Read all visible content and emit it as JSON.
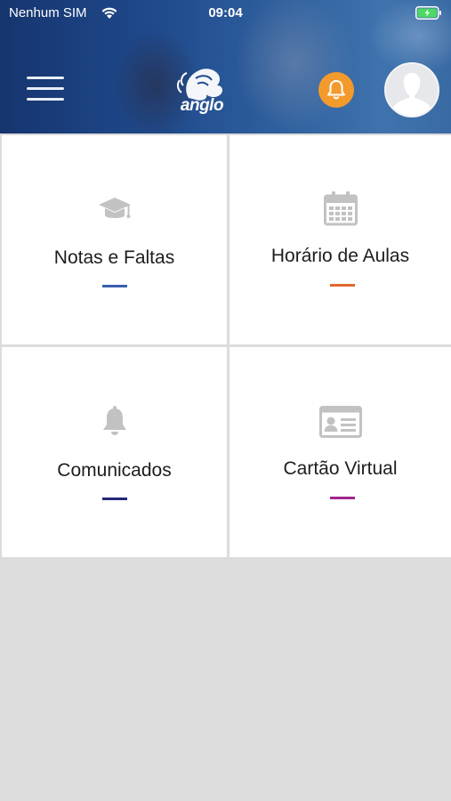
{
  "status_bar": {
    "carrier": "Nenhum SIM",
    "time": "09:04"
  },
  "header": {
    "logo_text": "anglo",
    "notification_icon": "bell-icon",
    "menu_icon": "hamburger-menu-icon",
    "avatar_icon": "user-avatar-icon"
  },
  "tiles": [
    {
      "label": "Notas e Faltas",
      "icon": "graduation-cap-icon",
      "accent": "#3b5fae"
    },
    {
      "label": "Horário de Aulas",
      "icon": "calendar-icon",
      "accent": "#e2682f"
    },
    {
      "label": "Comunicados",
      "icon": "bell-icon",
      "accent": "#24287a"
    },
    {
      "label": "Cartão Virtual",
      "icon": "id-card-icon",
      "accent": "#a3258e"
    }
  ],
  "colors": {
    "notification_badge": "#f39a2c",
    "background": "#dcdcdc",
    "icon_gray": "#c2c2c2"
  }
}
